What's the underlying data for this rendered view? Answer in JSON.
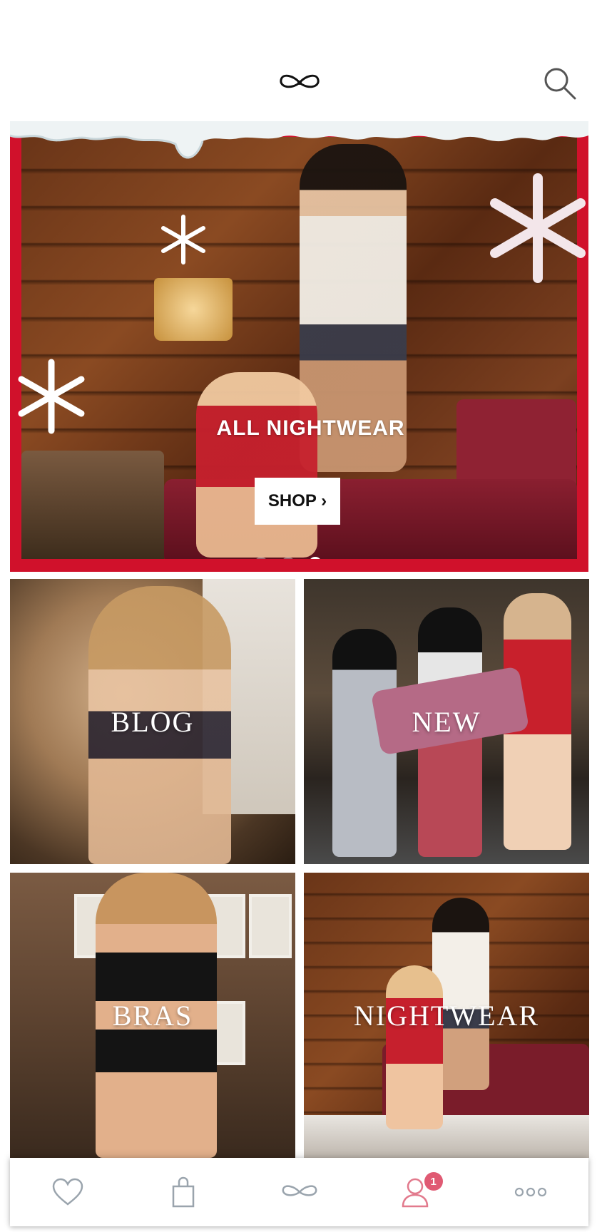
{
  "colors": {
    "accent": "#d0112b",
    "icon_gray": "#9aa4ad",
    "account_pink": "#e27a8d",
    "badge": "#e05a73"
  },
  "header": {
    "logo": "bow-logo-icon",
    "search_icon": "search-icon"
  },
  "hero": {
    "title": "ALL NIGHTWEAR",
    "cta": "SHOP ›",
    "slides_total": 3,
    "active_slide": 3
  },
  "tiles": [
    {
      "label": "BLOG"
    },
    {
      "label": "NEW"
    },
    {
      "label": "BRAS"
    },
    {
      "label": "NIGHTWEAR"
    }
  ],
  "bottom_nav": {
    "items": [
      {
        "icon": "heart-icon"
      },
      {
        "icon": "shopping-bag-icon"
      },
      {
        "icon": "bow-logo-icon"
      },
      {
        "icon": "account-icon",
        "badge": "1"
      },
      {
        "icon": "more-icon"
      }
    ]
  }
}
